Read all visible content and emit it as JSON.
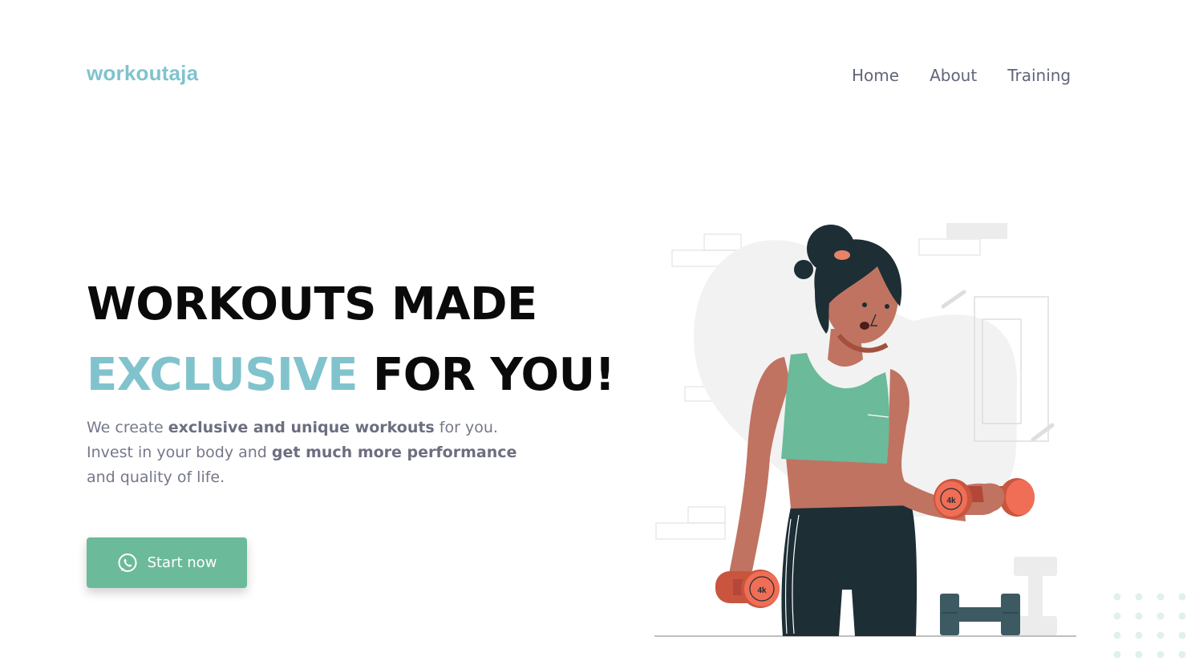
{
  "header": {
    "logo": "workoutaja",
    "nav": [
      "Home",
      "About",
      "Training"
    ]
  },
  "hero": {
    "title_line1": "WORKOUTS MADE",
    "title_accent": "EXCLUSIVE",
    "title_rest": " FOR YOU!",
    "text": {
      "p1": "We create ",
      "b1": "exclusive and unique workouts",
      "p2": " for you.",
      "p3": "Invest in your body and ",
      "b2": "get much more performance",
      "p4": "and quality of life."
    },
    "cta_label": "Start now",
    "cta_icon": "whatsapp-icon"
  },
  "illustration": {
    "dumbbell_weight": "4k"
  },
  "colors": {
    "accent": "#80c3cd",
    "button": "#6bba9a",
    "text": "#75788a"
  }
}
